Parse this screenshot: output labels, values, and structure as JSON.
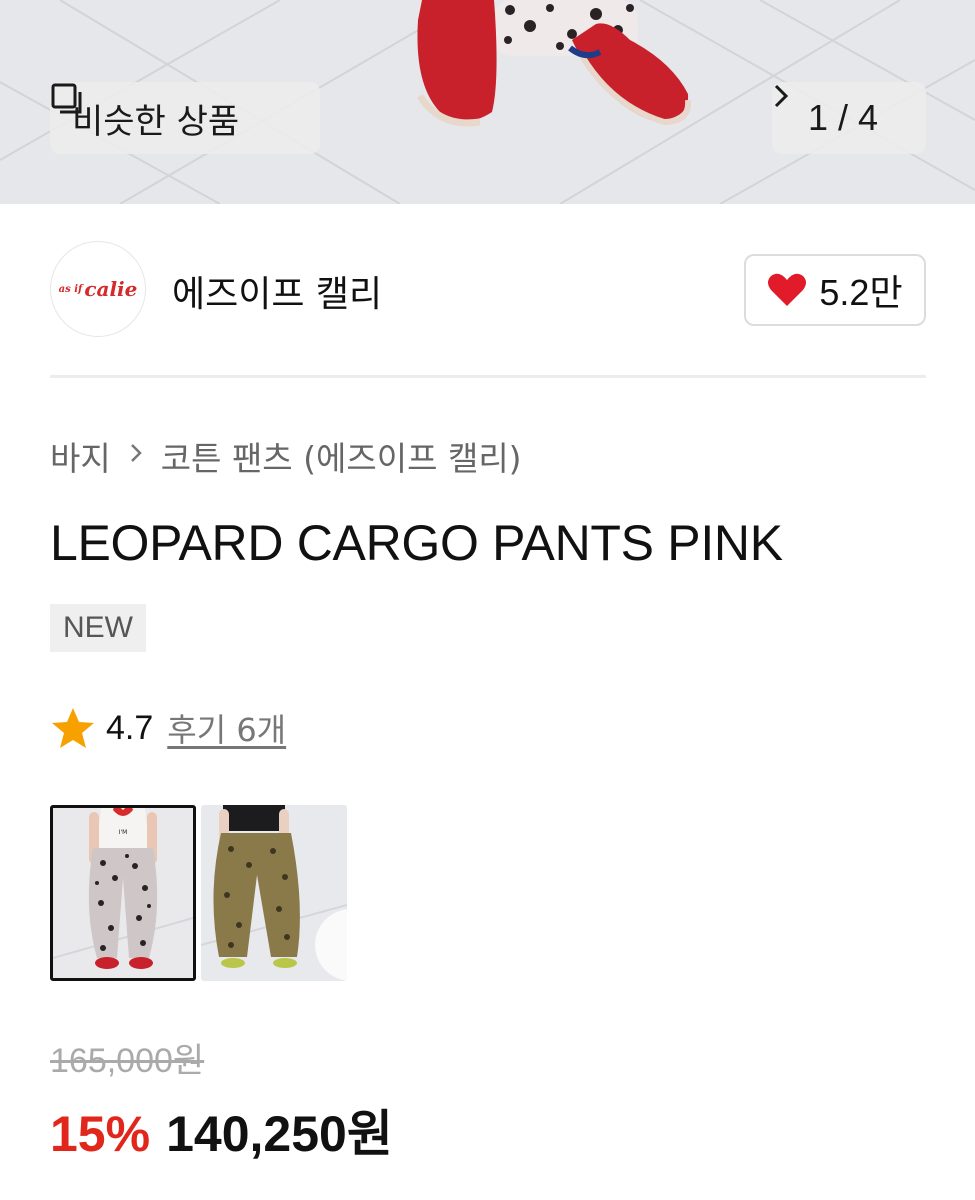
{
  "hero": {
    "similar_label": "비슷한 상품",
    "current_image": 1,
    "total_images": 4,
    "pager_text": "1 / 4"
  },
  "brand": {
    "logo_small": "as if",
    "logo_large": "calie",
    "name": "에즈이프 캘리",
    "likes": "5.2만"
  },
  "breadcrumb": [
    "바지",
    "코튼 팬츠 (에즈이프 캘리)"
  ],
  "product": {
    "title": "LEOPARD CARGO PANTS PINK",
    "badge": "NEW",
    "rating": "4.7",
    "reviews_label": "후기 6개",
    "rating_value": 4.7
  },
  "thumbnails": [
    {
      "selected": true
    },
    {
      "selected": false
    }
  ],
  "price": {
    "original": "165,000원",
    "discount": "15%",
    "sale": "140,250원"
  },
  "colors": {
    "discount_red": "#e1261c",
    "heart_red": "#e11b2a",
    "star_orange": "#f6a100"
  }
}
